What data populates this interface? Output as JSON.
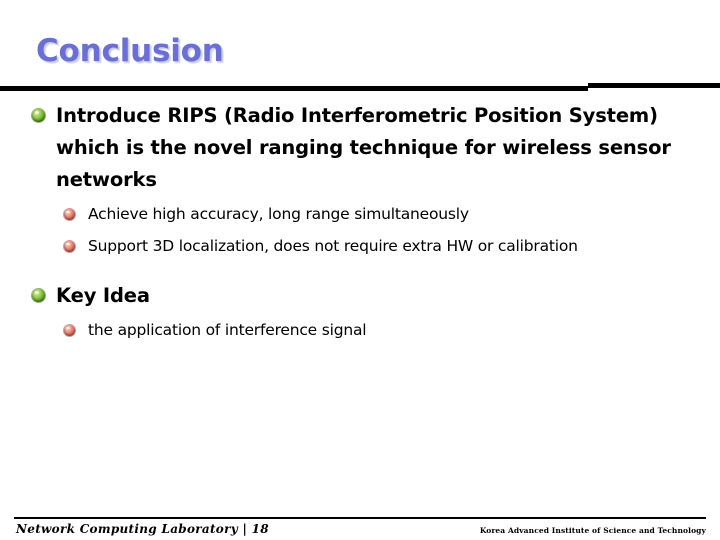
{
  "slide": {
    "title": "Conclusion",
    "title_color": "#6a6fd6",
    "background_color": "#ffffff",
    "rule_color": "#000000"
  },
  "bullets": {
    "level1_marker": "green-gem-bullet-icon",
    "level2_marker": "red-gem-bullet-icon",
    "level1_marker_color": "#4e9a16",
    "level2_marker_color": "#d1584a",
    "items": [
      {
        "level": 1,
        "text": "Introduce RIPS (Radio Interferometric Position System) which is the novel ranging technique for wireless sensor networks"
      },
      {
        "level": 2,
        "text": "Achieve high accuracy, long range simultaneously"
      },
      {
        "level": 2,
        "text": "Support 3D localization, does not require extra HW or calibration"
      },
      {
        "level": 1,
        "text": "Key Idea"
      },
      {
        "level": 2,
        "text": "the application of interference signal"
      }
    ]
  },
  "footer": {
    "left": "Network Computing Laboratory |  18",
    "right": "Korea Advanced Institute of Science and Technology"
  }
}
